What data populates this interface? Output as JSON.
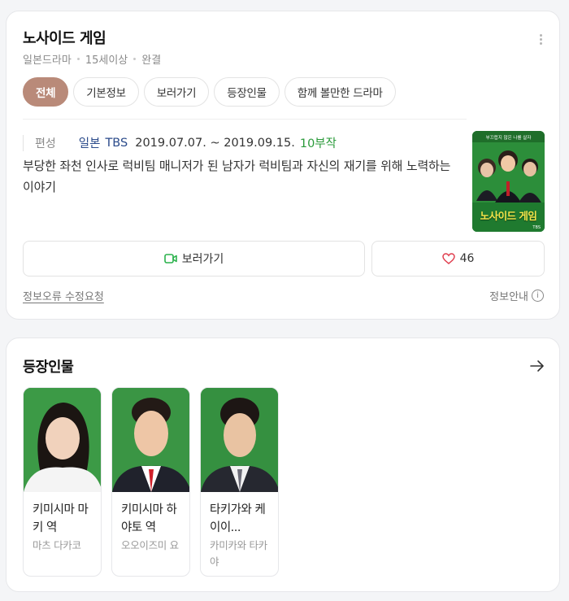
{
  "title": "노사이드 게임",
  "meta": [
    "일본드라마",
    "15세이상",
    "완결"
  ],
  "tabs": [
    "전체",
    "기본정보",
    "보러가기",
    "등장인물",
    "함께 볼만한 드라마"
  ],
  "info": {
    "label": "편성",
    "country": "일본",
    "network": "TBS",
    "dates": "2019.07.07. ~ 2019.09.15.",
    "episodes": "10부작",
    "description": "부당한 좌천 인사로 럭비팀 매니저가 된 남자가 럭비팀과 자신의 재기를 위해 노력하는 이야기"
  },
  "poster": {
    "tagline": "부끄럽지 않은 나를 살자",
    "title": "노사이드 게임",
    "network": "TBS"
  },
  "buttons": {
    "watch": "보러가기",
    "likes": "46"
  },
  "footer": {
    "report": "정보오류 수정요청",
    "guide": "정보안내",
    "guide_icon": "i"
  },
  "cast_section": {
    "title": "등장인물",
    "members": [
      {
        "role": "키미시마 마키 역",
        "actor": "마츠 다카코"
      },
      {
        "role": "키미시마 하야토 역",
        "actor": "오오이즈미 요"
      },
      {
        "role": "타키가와 케이이...",
        "actor": "카미카와 타카야"
      }
    ]
  },
  "colors": {
    "active_tab": "#b98a79",
    "episodes": "#2a9a3a",
    "link": "#2a4a8a",
    "watch_icon": "#2bb24c",
    "heart": "#e04050",
    "photo_bg": "#2f8a3c"
  }
}
